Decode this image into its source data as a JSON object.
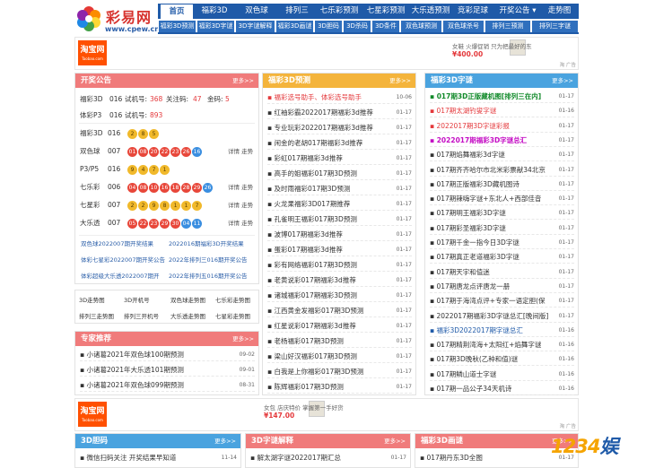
{
  "header": {
    "logo_name": "彩易网",
    "logo_url": "www.cpew.cn",
    "nav": [
      {
        "label": "首页",
        "active": true
      },
      {
        "label": "福彩3D"
      },
      {
        "label": "双色球"
      },
      {
        "label": "排列三"
      },
      {
        "label": "七乐彩预测"
      },
      {
        "label": "七星彩预测"
      },
      {
        "label": "大乐透预测"
      },
      {
        "label": "竞彩足球"
      },
      {
        "label": "开奖公告 ▾"
      },
      {
        "label": "走势图"
      }
    ],
    "subnav": [
      "福彩3D预测",
      "福彩3D字谜",
      "3D字谜解释",
      "福彩3D画谜",
      "3D胆码",
      "3D杀码",
      "3D条件",
      "双色球预测",
      "双色球杀号",
      "排列三预测",
      "排列三字谜"
    ]
  },
  "ad1": {
    "logo_main": "淘宝网",
    "logo_sub": "Taobao.com",
    "line": "女鞋 火爆促销 只为把最好的东",
    "price": "¥400.00",
    "corner": "淘 广告"
  },
  "ad2": {
    "logo_main": "淘宝网",
    "logo_sub": "Taobao.com",
    "line": "女包 店庆特价 掌握第一手好货",
    "price": "¥147.00",
    "corner": "淘 广告"
  },
  "notice": {
    "title": "开奖公告",
    "more": "更多>>",
    "top_lines": [
      {
        "name": "福彩3D",
        "issue": "016",
        "k1": "试机号:",
        "v1": "368",
        "k2": "关注码:",
        "v2": "47",
        "k3": "金码:",
        "v3": "5"
      },
      {
        "name": "体彩P3",
        "issue": "016",
        "k1": "试机号:",
        "v1": "893"
      }
    ],
    "draws": [
      {
        "name": "福彩3D",
        "issue": "016",
        "balls": [
          {
            "n": "2",
            "c": "y"
          },
          {
            "n": "8",
            "c": "y"
          },
          {
            "n": "5",
            "c": "y"
          }
        ],
        "link": ""
      },
      {
        "name": "双色球",
        "issue": "007",
        "balls": [
          {
            "n": "01",
            "c": "r"
          },
          {
            "n": "08",
            "c": "r"
          },
          {
            "n": "20",
            "c": "r"
          },
          {
            "n": "22",
            "c": "r"
          },
          {
            "n": "23",
            "c": "r"
          },
          {
            "n": "26",
            "c": "r"
          },
          {
            "n": "16",
            "c": "b"
          }
        ],
        "link": "详情 走势"
      },
      {
        "name": "P3/P5",
        "issue": "016",
        "balls": [
          {
            "n": "9",
            "c": "y"
          },
          {
            "n": "4",
            "c": "y"
          },
          {
            "n": "7",
            "c": "y"
          },
          {
            "n": "1",
            "c": "y"
          }
        ],
        "link": ""
      },
      {
        "name": "七乐彩",
        "issue": "006",
        "balls": [
          {
            "n": "04",
            "c": "r"
          },
          {
            "n": "08",
            "c": "r"
          },
          {
            "n": "10",
            "c": "r"
          },
          {
            "n": "16",
            "c": "r"
          },
          {
            "n": "18",
            "c": "r"
          },
          {
            "n": "28",
            "c": "r"
          },
          {
            "n": "29",
            "c": "r"
          },
          {
            "n": "26",
            "c": "b"
          }
        ],
        "link": "详情 走势"
      },
      {
        "name": "七星彩",
        "issue": "007",
        "balls": [
          {
            "n": "2",
            "c": "y"
          },
          {
            "n": "2",
            "c": "y"
          },
          {
            "n": "9",
            "c": "y"
          },
          {
            "n": "8",
            "c": "y"
          },
          {
            "n": "1",
            "c": "y"
          },
          {
            "n": "1",
            "c": "y"
          },
          {
            "n": "7",
            "c": "y"
          }
        ],
        "link": "详情 走势"
      },
      {
        "name": "大乐透",
        "issue": "007",
        "balls": [
          {
            "n": "05",
            "c": "r"
          },
          {
            "n": "22",
            "c": "r"
          },
          {
            "n": "23",
            "c": "r"
          },
          {
            "n": "29",
            "c": "r"
          },
          {
            "n": "30",
            "c": "r"
          },
          {
            "n": "04",
            "c": "b"
          },
          {
            "n": "11",
            "c": "b"
          }
        ],
        "link": "详情 走势"
      }
    ],
    "draw_links": [
      "详情 走势",
      "详情 走势",
      "详情 走势",
      "详情 走势",
      "详情 走势",
      "详情 走势"
    ],
    "bottom_links": [
      "双色球2022007期开奖结果",
      "2022016期福彩3D开奖结果",
      "体彩七星彩2022007期开奖公告",
      "2022年排列三016期开奖公告",
      "体彩超级大乐透2022007期开",
      "2022年排列五016期开奖公告"
    ]
  },
  "tools": [
    "3D走势图",
    "3D开机号",
    "双色球走势图",
    "七乐彩走势图",
    "排列三走势图",
    "排列三开机号",
    "大乐透走势图",
    "七星彩走势图"
  ],
  "expert": {
    "title": "专家推荐",
    "more": "更多>>",
    "items": [
      {
        "text": "小诸葛2021年双色球100期预测",
        "date": "09-02"
      },
      {
        "text": "小诸葛2021年大乐透101期预测",
        "date": "09-01"
      },
      {
        "text": "小诸葛2021年双色球099期预测",
        "date": "08-31"
      }
    ]
  },
  "fc3d_pred": {
    "title": "福彩3D预测",
    "more": "更多>>",
    "items": [
      {
        "text": "福彩选号助手、体彩选号助手",
        "date": "10-06",
        "style": "red"
      },
      {
        "text": "红袖彩霸2022017期福彩3d推荐",
        "date": "01-17"
      },
      {
        "text": "专业玩彩2022017期福彩3d推荐",
        "date": "01-17"
      },
      {
        "text": "闲金的老胡017期福彩3d推荐",
        "date": "01-17"
      },
      {
        "text": "彩虹017期福彩3d推荐",
        "date": "01-17"
      },
      {
        "text": "高手的姐福彩017期3D预测",
        "date": "01-17"
      },
      {
        "text": "及时雨福彩017期3D预测",
        "date": "01-17"
      },
      {
        "text": "火龙果福彩3D017期推荐",
        "date": "01-17"
      },
      {
        "text": "孔雀明王福彩017期3D预测",
        "date": "01-17"
      },
      {
        "text": "波博017期福彩3d推荐",
        "date": "01-17"
      },
      {
        "text": "蛋彩017期福彩3d推荐",
        "date": "01-17"
      },
      {
        "text": "彩有网络福彩017期3D预测",
        "date": "01-17"
      },
      {
        "text": "老黄说彩017期福彩3d推荐",
        "date": "01-17"
      },
      {
        "text": "诸城福彩017期福彩3D预测",
        "date": "01-17"
      },
      {
        "text": "江西黄金发福彩017期3D预测",
        "date": "01-17"
      },
      {
        "text": "红星说彩017期福彩3d推荐",
        "date": "01-17"
      },
      {
        "text": "老杨福彩017期3D预测",
        "date": "01-17"
      },
      {
        "text": "梁山好汉福彩017期3D预测",
        "date": "01-17"
      },
      {
        "text": "白我是上你福彩017期3D预测",
        "date": "01-17"
      },
      {
        "text": "陈辉福彩017期3D预测",
        "date": "01-17"
      }
    ]
  },
  "fc3d_zimi": {
    "title": "福彩3D字谜",
    "more": "更多>>",
    "items": [
      {
        "text": "017期3D正版藏机图[排列三在内]",
        "date": "01-17",
        "style": "green"
      },
      {
        "text": "017期太湖钓叟字谜",
        "date": "01-16",
        "style": "red"
      },
      {
        "text": "2022017期3D字谜彩报",
        "date": "01-17",
        "style": "red"
      },
      {
        "text": "2022017期福彩3D字谜总汇",
        "date": "01-17",
        "style": "purple"
      },
      {
        "text": "017期焰舞福彩3d字谜",
        "date": "01-17"
      },
      {
        "text": "017期齐齐哈尔市北米彩票献34北京",
        "date": "01-17"
      },
      {
        "text": "017期正版福彩3D藏机图诗",
        "date": "01-17"
      },
      {
        "text": "017期辣嗨字谜+东北人+西部佳音",
        "date": "01-17"
      },
      {
        "text": "017期明王福彩3D字谜",
        "date": "01-17"
      },
      {
        "text": "017期彩圣福彩3D字谜",
        "date": "01-17"
      },
      {
        "text": "017期千金一指今日3D字谜",
        "date": "01-17"
      },
      {
        "text": "017期真正老道福彩3D字谜",
        "date": "01-17"
      },
      {
        "text": "017期天宇和值迷",
        "date": "01-17"
      },
      {
        "text": "017期唐龙点评唐龙一册",
        "date": "01-17"
      },
      {
        "text": "017期于海湾点评+专家一语定胆(保",
        "date": "01-17"
      },
      {
        "text": "2022017期福彩3D字谜总汇[晚间版]",
        "date": "01-17"
      },
      {
        "text": "福彩3D2022017期字谜总汇",
        "date": "01-16",
        "style": "blue"
      },
      {
        "text": "017期精荆湾海+太阳红+焰舞字谜",
        "date": "01-16"
      },
      {
        "text": "017期3D晚秋(乙种和值)谜",
        "date": "01-16"
      },
      {
        "text": "017期鳞山道士字谜",
        "date": "01-16"
      },
      {
        "text": "017期一品公子34天机诗",
        "date": "01-16"
      }
    ]
  },
  "dm3d": {
    "title": "3D胆码",
    "more": "更多>>",
    "items": [
      {
        "text": "微信扫码关注 开奖结果早知道",
        "date": "11-14"
      }
    ]
  },
  "zimi_explain": {
    "title": "3D字谜解释",
    "more": "更多>>",
    "items": [
      {
        "text": "解太湖字谜2022017期汇总",
        "date": "01-17"
      }
    ]
  },
  "huami": {
    "title": "福彩3D画谜",
    "more": "更多>>",
    "items": [
      {
        "text": "017期丹东3D全图",
        "date": "01-17"
      }
    ]
  },
  "watermark": {
    "a": "1234",
    "b": "娱"
  }
}
